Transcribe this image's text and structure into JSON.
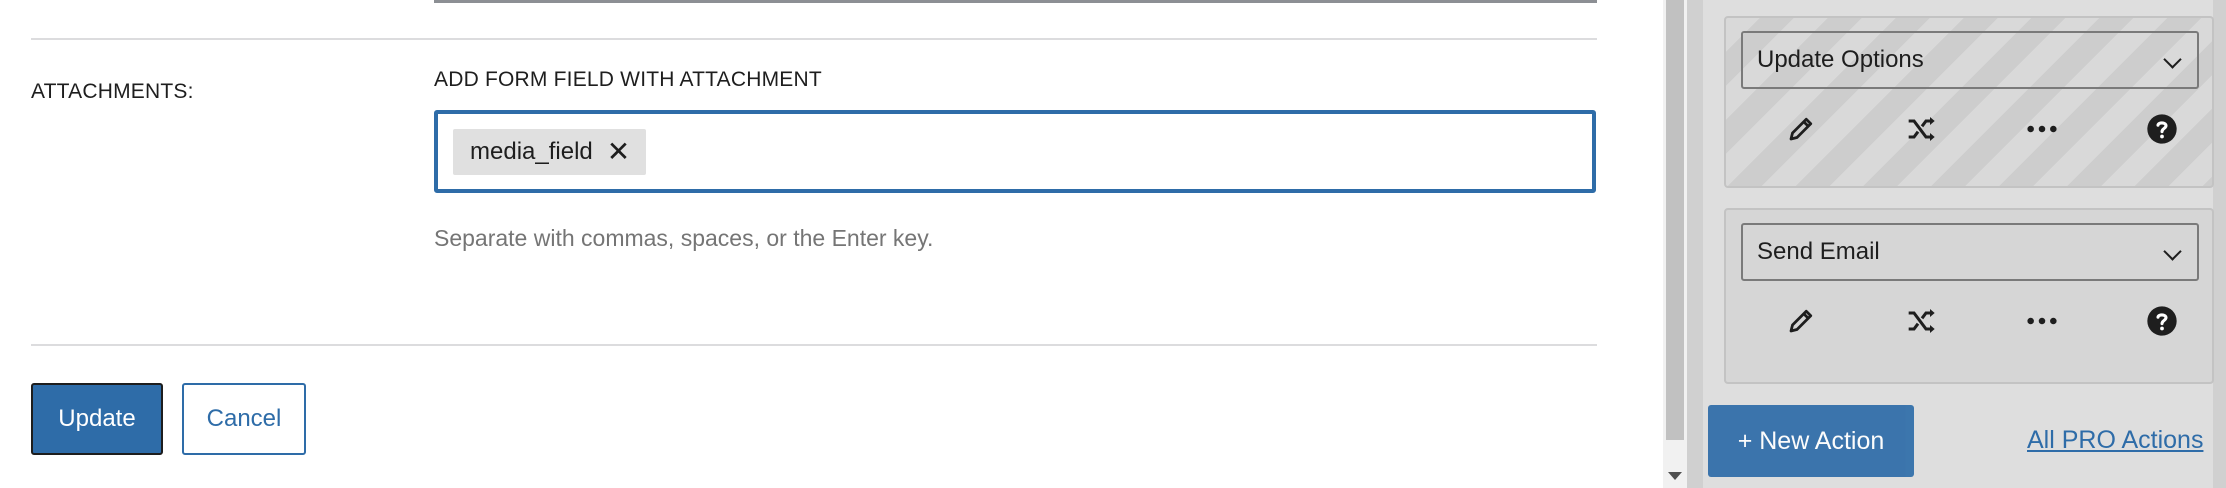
{
  "form": {
    "attachments_label": "ATTACHMENTS:",
    "add_field_label": "ADD FORM FIELD WITH ATTACHMENT",
    "tokens": [
      "media_field"
    ],
    "token_remove_glyph": "✕",
    "help_text": "Separate with commas, spaces, or the Enter key.",
    "update_button": "Update",
    "cancel_button": "Cancel"
  },
  "sidebar": {
    "actions": [
      {
        "select_value": "Update Options",
        "icons": [
          "pencil-icon",
          "shuffle-icon",
          "more-dots-icon",
          "help-circle-icon"
        ],
        "striped": true
      },
      {
        "select_value": "Send Email",
        "icons": [
          "pencil-icon",
          "shuffle-icon",
          "more-dots-icon",
          "help-circle-icon"
        ],
        "striped": false
      }
    ],
    "new_action_button": "+ New Action",
    "all_pro_link": "All PRO Actions"
  },
  "colors": {
    "accent": "#2e6ca8",
    "help_text": "#757575",
    "divider": "#dcdcde",
    "sidebar_bg": "#dedede"
  }
}
